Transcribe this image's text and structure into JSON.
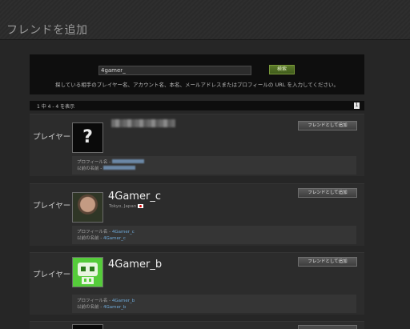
{
  "header": {
    "title": "フレンドを追加"
  },
  "search": {
    "value": "4gamer_",
    "button_label": "検索",
    "hint": "探している相手のプレイヤー名、アカウント名、本名、メールアドレスまたはプロフィールの URL を入力してください。"
  },
  "results": {
    "count_text": "1 中 4 - 4 を表示",
    "page": "1"
  },
  "colors": {
    "accent_green": "#5b7a2a",
    "link_blue": "#6fa9d8",
    "panel_dark": "#0e0e0e"
  },
  "cards": [
    {
      "label": "プレイヤー",
      "avatar": "question-mark-avatar",
      "add_label": "フレンドとして追加",
      "profile_label": "プロフィール名 - ",
      "former_label": "以前の名前 - "
    },
    {
      "label": "プレイヤー",
      "name": "4Gamer_c",
      "location": "Tokyo, Japan",
      "avatar": "photo-avatar",
      "add_label": "フレンドとして追加",
      "profile_label": "プロフィール名 - ",
      "profile_value": "4Gamer_c",
      "former_label": "以前の名前 - ",
      "former_value": "4Gamer_c"
    },
    {
      "label": "プレイヤー",
      "name": "4Gamer_b",
      "avatar": "green-robot-avatar",
      "add_label": "フレンドとして追加",
      "profile_label": "プロフィール名 - ",
      "profile_value": "4Gamer_b",
      "former_label": "以前の名前 - ",
      "former_value": "4Gamer_b"
    }
  ]
}
